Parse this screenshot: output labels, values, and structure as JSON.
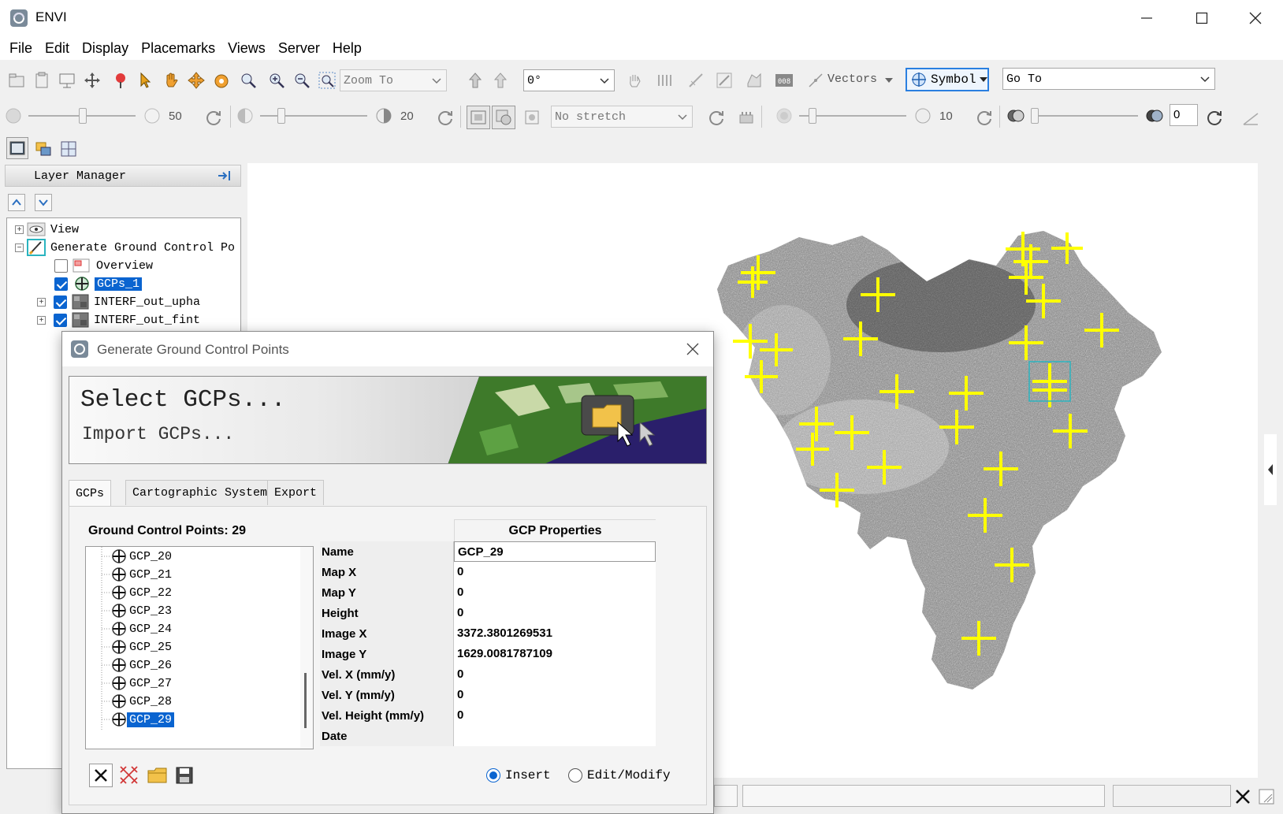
{
  "window": {
    "title": "ENVI"
  },
  "menu": [
    "File",
    "Edit",
    "Display",
    "Placemarks",
    "Views",
    "Server",
    "Help"
  ],
  "toolbar": {
    "zoom_combo": "Zoom To",
    "rotation_combo": "0°",
    "vectors_label": "Vectors",
    "symbol_label": "Symbol",
    "goto_combo": "Go To",
    "brightness_value": "50",
    "contrast_value": "20",
    "stretch_combo": "No stretch",
    "sharpen_value": "10",
    "transparency_value": "0"
  },
  "layer_manager": {
    "title": "Layer Manager",
    "items": [
      {
        "label": "View"
      },
      {
        "label": "Generate Ground Control Po"
      },
      {
        "label": "Overview",
        "checked": false
      },
      {
        "label": "GCPs_1",
        "checked": true,
        "selected": true
      },
      {
        "label": "INTERF_out_upha",
        "checked": true
      },
      {
        "label": "INTERF_out_fint",
        "checked": true
      }
    ]
  },
  "dialog": {
    "title": "Generate Ground Control Points",
    "banner_title": "Select GCPs...",
    "banner_subtitle": "Import GCPs...",
    "tabs": [
      "GCPs",
      "Cartographic System",
      "Export"
    ],
    "active_tab": "GCPs",
    "gcp_count_label": "Ground Control Points: 29",
    "gcp_list": [
      "GCP_20",
      "GCP_21",
      "GCP_22",
      "GCP_23",
      "GCP_24",
      "GCP_25",
      "GCP_26",
      "GCP_27",
      "GCP_28",
      "GCP_29"
    ],
    "selected_gcp": "GCP_29",
    "properties_header": "GCP Properties",
    "properties": [
      {
        "key": "Name",
        "value": "GCP_29"
      },
      {
        "key": "Map X",
        "value": "0"
      },
      {
        "key": "Map Y",
        "value": "0"
      },
      {
        "key": "Height",
        "value": "0"
      },
      {
        "key": "Image X",
        "value": "3372.3801269531"
      },
      {
        "key": "Image Y",
        "value": "1629.0081787109"
      },
      {
        "key": "Vel. X (mm/y)",
        "value": "0"
      },
      {
        "key": "Vel. Y (mm/y)",
        "value": "0"
      },
      {
        "key": "Vel. Height (mm/y)",
        "value": "0"
      },
      {
        "key": "Date",
        "value": ""
      }
    ],
    "mode_insert": "Insert",
    "mode_edit": "Edit/Modify",
    "mode_selected": "Insert"
  },
  "colors": {
    "selection": "#0a64d0",
    "gcp_marker": "#ffff00"
  }
}
